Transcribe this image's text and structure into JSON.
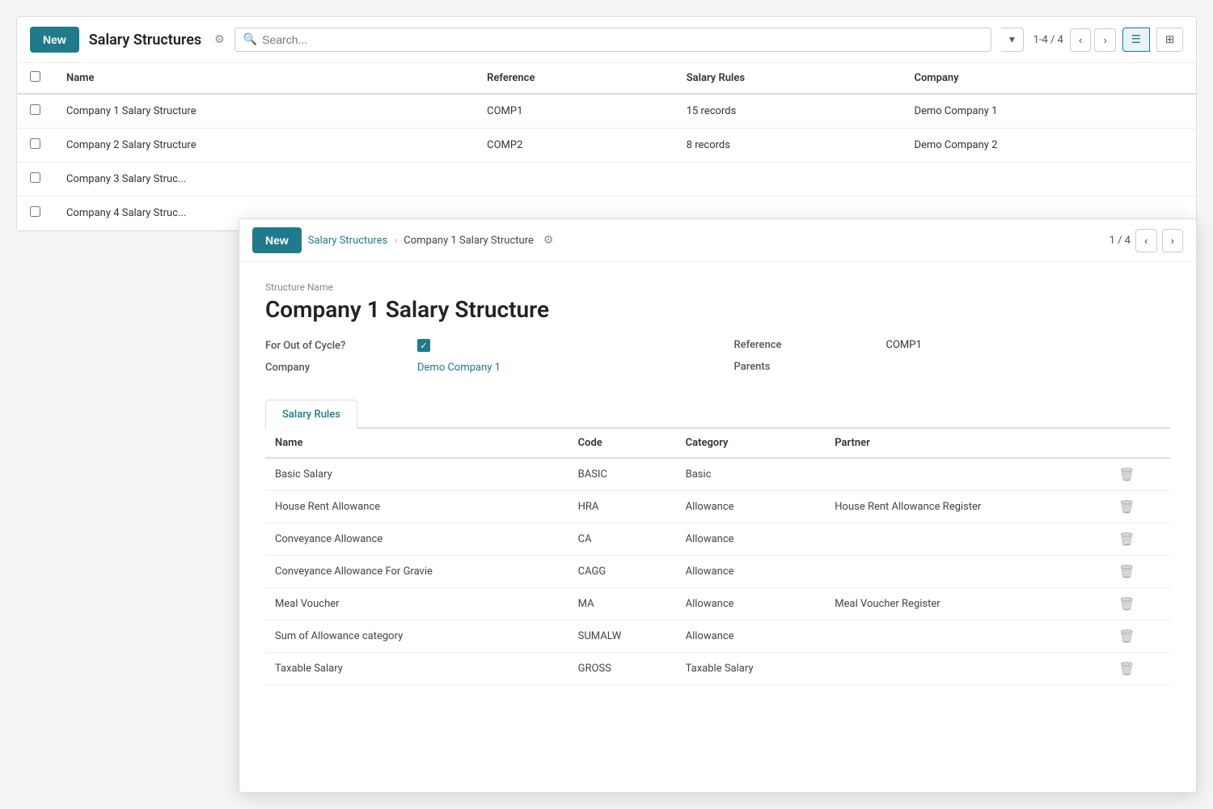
{
  "listView": {
    "newButtonLabel": "New",
    "pageTitle": "Salary Structures",
    "search": {
      "placeholder": "Search..."
    },
    "pagination": "1-4 / 4",
    "columns": [
      "Name",
      "Reference",
      "Salary Rules",
      "Company"
    ],
    "rows": [
      {
        "name": "Company 1 Salary Structure",
        "reference": "COMP1",
        "salaryRules": "15 records",
        "company": "Demo Company 1"
      },
      {
        "name": "Company 2 Salary Structure",
        "reference": "COMP2",
        "salaryRules": "8 records",
        "company": "Demo Company 2"
      },
      {
        "name": "Company 3 Salary Struc...",
        "reference": "",
        "salaryRules": "",
        "company": ""
      },
      {
        "name": "Company 4 Salary Struc...",
        "reference": "",
        "salaryRules": "",
        "company": ""
      }
    ]
  },
  "detailPanel": {
    "breadcrumb": {
      "parent": "Salary Structures",
      "current": "Company 1 Salary Structure"
    },
    "newButtonLabel": "New",
    "pagination": "1 / 4",
    "structureNameLabel": "Structure Name",
    "structureName": "Company 1 Salary Structure",
    "fields": {
      "forOutOfCycleLabel": "For Out of Cycle?",
      "forOutOfCycle": true,
      "referenceLabel": "Reference",
      "reference": "COMP1",
      "companyLabel": "Company",
      "company": "Demo Company 1",
      "parentsLabel": "Parents",
      "parents": ""
    },
    "tab": "Salary Rules",
    "tableColumns": [
      "Name",
      "Code",
      "Category",
      "Partner"
    ],
    "rules": [
      {
        "name": "Basic Salary",
        "code": "BASIC",
        "category": "Basic",
        "partner": "",
        "deletable": true
      },
      {
        "name": "House Rent Allowance",
        "code": "HRA",
        "category": "Allowance",
        "partner": "House Rent Allowance Register",
        "deletable": true
      },
      {
        "name": "Conveyance Allowance",
        "code": "CA",
        "category": "Allowance",
        "partner": "",
        "deletable": true
      },
      {
        "name": "Conveyance Allowance For Gravie",
        "code": "CAGG",
        "category": "Allowance",
        "partner": "",
        "deletable": true
      },
      {
        "name": "Meal Voucher",
        "code": "MA",
        "category": "Allowance",
        "partner": "Meal Voucher Register",
        "deletable": true
      },
      {
        "name": "Sum of Allowance category",
        "code": "SUMALW",
        "category": "Allowance",
        "partner": "",
        "deletable": true
      },
      {
        "name": "Taxable Salary",
        "code": "GROSS",
        "category": "Taxable Salary",
        "partner": "",
        "deletable": true
      }
    ]
  },
  "icons": {
    "gear": "⚙",
    "search": "🔍",
    "dropdownArrow": "▾",
    "navLeft": "‹",
    "navRight": "›",
    "listView": "☰",
    "kanbanView": "⊞",
    "delete": "🗑"
  },
  "colors": {
    "primary": "#1f7a8c",
    "border": "#ddd",
    "text": "#333"
  }
}
